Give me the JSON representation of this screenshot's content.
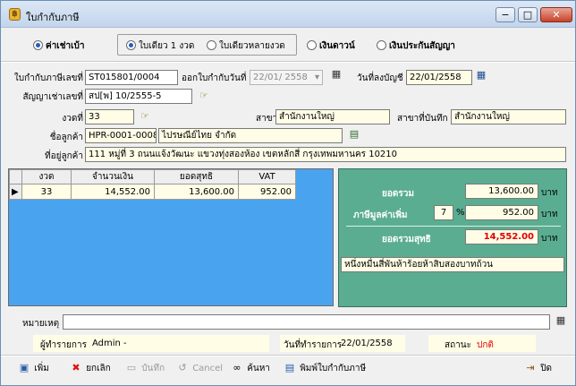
{
  "window": {
    "title": "ใบกำกับภาษี",
    "min": "−",
    "max": "□",
    "close": "✕"
  },
  "mode": {
    "rent_label": "ค่าเช่าเบ้า",
    "single_label": "ใบเดียว 1 งวด",
    "multi_label": "ใบเดียวหลายงวด",
    "down_label": "เงินดาวน์",
    "insurance_label": "เงินประกันสัญญา"
  },
  "form": {
    "invoice_no_label": "ใบกำกับภาษีเลขที่",
    "invoice_no": "ST015801/0004",
    "issue_date_label": "ออกใบกำกับวันที่",
    "issue_date": "22/01/ 2558",
    "post_date_label": "วันที่ลงบัญชี",
    "post_date": "22/01/2558",
    "contract_label": "สัญญาเช่าเลขที่",
    "contract_no": "สป[พ] 10/2555-5",
    "period_label": "งวดที่",
    "period": "33",
    "branch_label": "สาขา",
    "branch": "สำนักงานใหญ่",
    "record_branch_label": "สาขาที่บันทึก",
    "record_branch": "สำนักงานใหญ่",
    "customer_label": "ชื่อลูกค้า",
    "customer_code": "HPR-0001-00082",
    "customer_name": "ไปรษณีย์ไทย จำกัด",
    "address_label": "ที่อยู่ลูกค้า",
    "address": "111 หมู่ที่ 3 ถนนแจ้งวัฒนะ แขวงทุ่งสองห้อง เขตหลักสี่ กรุงเทพมหานคร 10210"
  },
  "grid": {
    "columns": [
      "งวด",
      "จำนวนเงิน",
      "ยอดสุทธิ",
      "VAT"
    ],
    "rows": [
      {
        "period": "33",
        "amount": "14,552.00",
        "net": "13,600.00",
        "vat": "952.00"
      }
    ]
  },
  "totals": {
    "total_label": "ยอดรวม",
    "total": "13,600.00",
    "vat_label": "ภาษีมูลค่าเพิ่ม",
    "vat_rate": "7",
    "percent": "%",
    "vat": "952.00",
    "grand_label": "ยอดรวมสุทธิ",
    "grand_total": "14,552.00",
    "currency": "บาท",
    "amount_words": "หนึ่งหมื่นสี่พันห้าร้อยห้าสิบสองบาทถ้วน"
  },
  "remark": {
    "label": "หมายเหตุ",
    "value": ""
  },
  "status": {
    "operator_label": "ผู้ทำรายการ",
    "operator": "Admin -",
    "date_label": "วันที่ทำรายการ",
    "date": "22/01/2558",
    "state_label": "สถานะ",
    "state": "ปกติ"
  },
  "toolbar": {
    "add": "เพิ่ม",
    "cancel_doc": "ยกเลิก",
    "save": "บันทึก",
    "cancel": "Cancel",
    "search": "ค้นหา",
    "print": "พิมพ์ใบกำกับภาษี",
    "exit": "ปิด"
  },
  "colors": {
    "accent_green": "#5aad90",
    "grid_blue": "#4aa3ef",
    "field_yellow": "#fffde6",
    "grand_red": "#e00000"
  },
  "icons": [
    "money-bag-icon",
    "calendar-icon",
    "search-hand-icon",
    "open-folder-icon",
    "add-document-icon",
    "cancel-x-icon",
    "save-disk-icon",
    "undo-icon",
    "binoculars-icon",
    "print-document-icon",
    "exit-door-icon"
  ]
}
